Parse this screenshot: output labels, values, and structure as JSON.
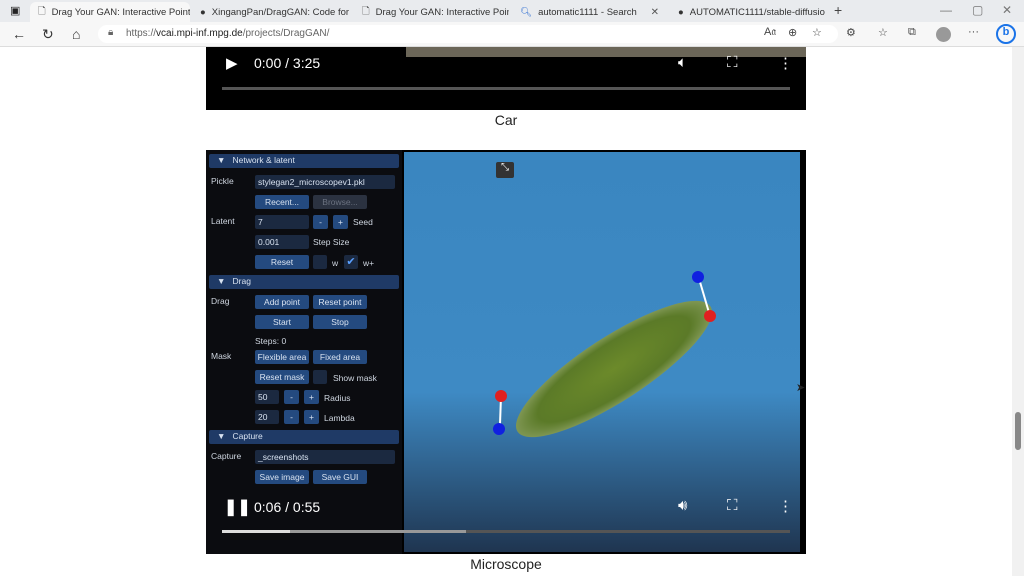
{
  "browser": {
    "tabs": [
      {
        "title": "Drag Your GAN: Interactive Point",
        "icon": "page-icon",
        "active": true
      },
      {
        "title": "XingangPan/DragGAN: Code for",
        "icon": "github-icon"
      },
      {
        "title": "Drag Your GAN: Interactive Point",
        "icon": "page-icon"
      },
      {
        "title": "automatic1111 - Search",
        "icon": "search-icon"
      },
      {
        "title": "AUTOMATIC1111/stable-diffusio",
        "icon": "github-icon"
      }
    ],
    "url_prefix": "https://",
    "url_host": "vcai.mpi-inf.mpg.de",
    "url_path": "/projects/DragGAN/"
  },
  "videos": [
    {
      "time": "0:00 / 3:25",
      "caption": "Car",
      "progress": 0
    },
    {
      "time": "0:06 / 0:55",
      "caption": "Microscope",
      "progress": 0.12,
      "buffered": 0.43
    }
  ],
  "panel": {
    "network_header": "Network & latent",
    "pickle_label": "Pickle",
    "pickle_value": "stylegan2_microscopev1.pkl",
    "recent": "Recent...",
    "browse": "Browse...",
    "latent_label": "Latent",
    "seed_value": "7",
    "minus": "-",
    "plus": "+",
    "seed_label": "Seed",
    "step_value": "0.001",
    "step_label": "Step Size",
    "reset": "Reset",
    "w_label": "w",
    "wplus_label": "w+",
    "drag_header": "Drag",
    "drag_label": "Drag",
    "add_point": "Add point",
    "reset_point": "Reset point",
    "start": "Start",
    "stop": "Stop",
    "steps": "Steps: 0",
    "mask_label": "Mask",
    "flexible": "Flexible area",
    "fixed": "Fixed area",
    "reset_mask": "Reset mask",
    "show_mask": "Show mask",
    "radius_value": "50",
    "radius_label": "Radius",
    "lambda_value": "20",
    "lambda_label": "Lambda",
    "capture_header": "Capture",
    "capture_label": "Capture",
    "capture_value": "_screenshots",
    "save_image": "Save image",
    "save_gui": "Save GUI"
  }
}
